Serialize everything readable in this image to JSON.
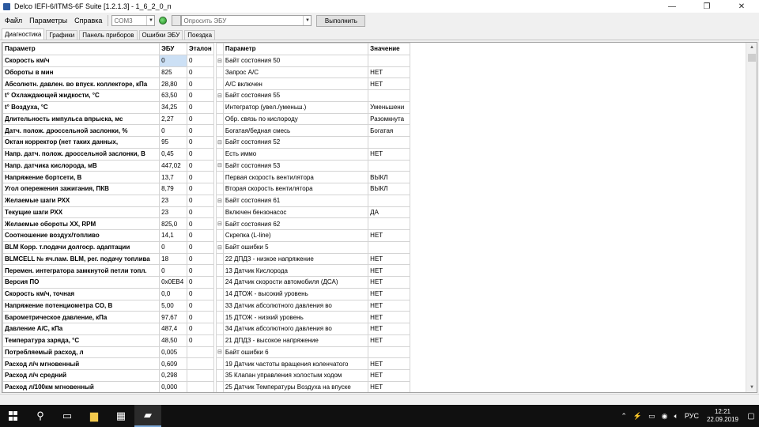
{
  "window": {
    "title": "Delco IEFI-6/ITMS-6F Suite [1.2.1.3] - 1_6_2_0_n",
    "controls": [
      "—",
      "❐",
      "✕"
    ]
  },
  "menu": {
    "file": "Файл",
    "params": "Параметры",
    "help": "Справка"
  },
  "toolbar": {
    "port_value": "COM3",
    "ecu_query_placeholder": "Опросить ЭБУ",
    "run_label": "Выполнить"
  },
  "tabs": [
    "Диагностика",
    "Графики",
    "Панель приборов",
    "Ошибки ЭБУ",
    "Поездка"
  ],
  "left_table": {
    "headers": [
      "Параметр",
      "ЭБУ",
      "Эталон"
    ],
    "rows": [
      [
        "Скорость км/ч",
        "0",
        "0"
      ],
      [
        "Обороты в мин",
        "825",
        "0"
      ],
      [
        "Абсолютн. давлен. во впуск. коллекторе, кПа",
        "28,80",
        "0"
      ],
      [
        "t° Охлаждающей жидкости, °C",
        "63,50",
        "0"
      ],
      [
        "t° Воздуха, °C",
        "34,25",
        "0"
      ],
      [
        "Длительность импульса впрыска, мс",
        "2,27",
        "0"
      ],
      [
        "Датч. полож. дроссельной заслонки, %",
        "0",
        "0"
      ],
      [
        "Октан корректор (нет таких данных,",
        "95",
        "0"
      ],
      [
        "Напр. датч. полож. дроссельной заслонки, В",
        "0,45",
        "0"
      ],
      [
        "Напр. датчика кислорода, мВ",
        "447,02",
        "0"
      ],
      [
        "Напряжение бортсети, В",
        "13,7",
        "0"
      ],
      [
        "Угол опережения зажигания, ПКВ",
        "8,79",
        "0"
      ],
      [
        "Желаемые шаги РХХ",
        "23",
        "0"
      ],
      [
        "Текущие шаги РХХ",
        "23",
        "0"
      ],
      [
        "Желаемые обороты ХХ, RPM",
        "825,0",
        "0"
      ],
      [
        "Соотношение воздух/топливо",
        "14,1",
        "0"
      ],
      [
        "BLM Корр. т.подачи долгоср. адаптации",
        "0",
        "0"
      ],
      [
        "BLMCELL № яч.пам. BLM, рег. подачу топлива",
        "18",
        "0"
      ],
      [
        "Перемен. интегратора замкнутой петли топл.",
        "0",
        "0"
      ],
      [
        "Версия ПО",
        "0x0EB4",
        "0"
      ],
      [
        "Скорость км/ч, точная",
        "0,0",
        "0"
      ],
      [
        "Напряжение потенциометра CO, В",
        "5,00",
        "0"
      ],
      [
        "Барометрическое давление, кПа",
        "97,67",
        "0"
      ],
      [
        "Давление А/С, кПа",
        "487,4",
        "0"
      ],
      [
        "Температура заряда, °C",
        "48,50",
        "0"
      ],
      [
        "Потребляемый расход, л",
        "0,005",
        ""
      ],
      [
        "Расход л/ч мгновенный",
        "0,609",
        ""
      ],
      [
        "Расход л/ч средний",
        "0,298",
        ""
      ],
      [
        "Расход л/100км мгновенный",
        "0,000",
        ""
      ]
    ]
  },
  "right_table": {
    "headers": [
      "Параметр",
      "Значение"
    ],
    "rows": [
      [
        "⊟",
        "Байт состояния 50",
        ""
      ],
      [
        "",
        "Запрос А/С",
        "НЕТ"
      ],
      [
        "",
        "А/С включен",
        "НЕТ"
      ],
      [
        "⊟",
        "Байт состояния 55",
        ""
      ],
      [
        "",
        "Интегратор (увел./уменьш.)",
        "Уменьшени"
      ],
      [
        "",
        "Обр. связь по кислороду",
        "Разомкнута"
      ],
      [
        "",
        "Богатая/бедная смесь",
        "Богатая"
      ],
      [
        "⊟",
        "Байт состояния 52",
        ""
      ],
      [
        "",
        "Есть иммо",
        "НЕТ"
      ],
      [
        "⊟",
        "Байт состояния 53",
        ""
      ],
      [
        "",
        "Первая скорость вентилятора",
        "ВЫКЛ"
      ],
      [
        "",
        "Вторая скорость вентилятора",
        "ВЫКЛ"
      ],
      [
        "⊟",
        "Байт состояния 61",
        ""
      ],
      [
        "",
        "Включен бензонасос",
        "ДА"
      ],
      [
        "⊟",
        "Байт состояния 62",
        ""
      ],
      [
        "",
        "Скрепка (L-line)",
        "НЕТ"
      ],
      [
        "⊟",
        "Байт ошибки 5",
        ""
      ],
      [
        "",
        "22 ДПДЗ - низкое напряжение",
        "НЕТ"
      ],
      [
        "",
        "13 Датчик Кислорода",
        "НЕТ"
      ],
      [
        "",
        "24 Датчик скорости автомобиля (ДСА)",
        "НЕТ"
      ],
      [
        "",
        "14 ДТОЖ - высокий уровень",
        "НЕТ"
      ],
      [
        "",
        "33 Датчик абсолютного давления во",
        "НЕТ"
      ],
      [
        "",
        "15 ДТОЖ - низкий уровень",
        "НЕТ"
      ],
      [
        "",
        "34 Датчик абсолютного давления во",
        "НЕТ"
      ],
      [
        "",
        "21 ДПДЗ - высокое напряжение",
        "НЕТ"
      ],
      [
        "⊟",
        "Байт ошибки 6",
        ""
      ],
      [
        "",
        "19 Датчик частоты вращения коленчатого",
        "НЕТ"
      ],
      [
        "",
        "35 Клапан управления холостым ходом",
        "НЕТ"
      ],
      [
        "",
        "25 Датчик Температуры Воздуха на впуске",
        "НЕТ"
      ]
    ]
  },
  "taskbar": {
    "lang": "РУС",
    "time": "12:21",
    "date": "22.09.2019"
  }
}
